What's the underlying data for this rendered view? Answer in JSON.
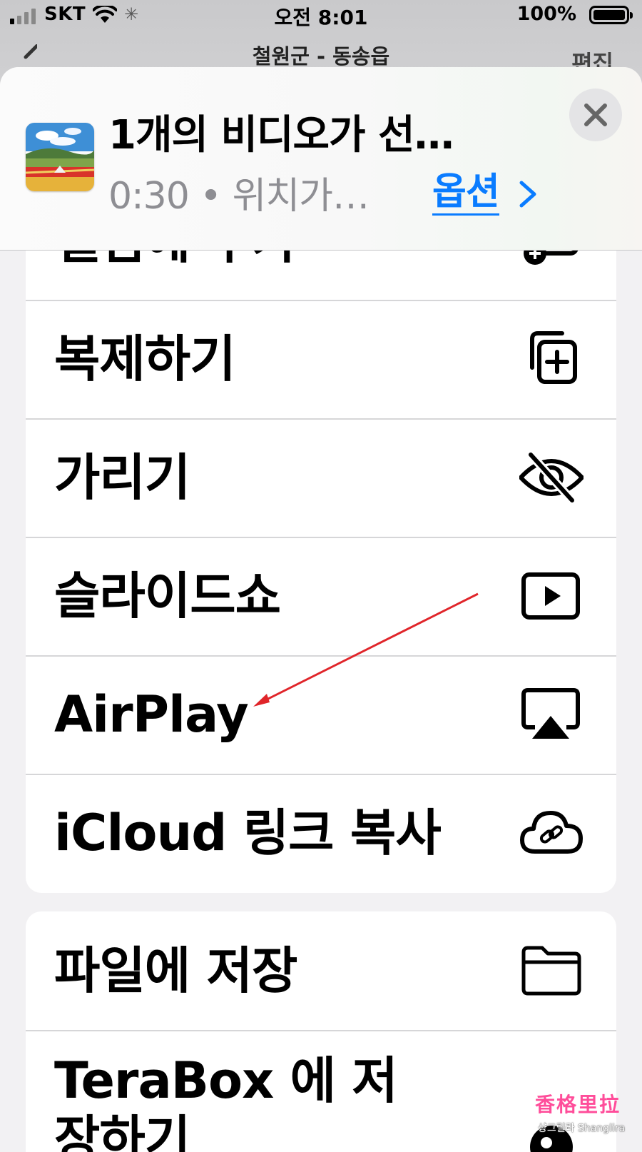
{
  "status_bar": {
    "carrier": "SKT",
    "time": "오전 8:01",
    "battery": "100%",
    "icons": [
      "signal-icon",
      "wifi-icon",
      "activity-spinner-icon",
      "battery-icon"
    ]
  },
  "nav": {
    "title": "철원군 - 동송읍",
    "edit_label": "편집",
    "back_icon": "chevron-left-icon"
  },
  "share_header": {
    "title": "1개의 비디오가 선…",
    "subtitle": "0:30 • 위치가…",
    "options_label": "옵션",
    "options_icon": "chevron-right-icon",
    "close_icon": "close-icon",
    "accent_color": "#0a7cff"
  },
  "actions_group_1": [
    {
      "label": "앨범에 추가",
      "icon": "add-to-album-icon"
    },
    {
      "label": "복제하기",
      "icon": "duplicate-icon"
    },
    {
      "label": "가리기",
      "icon": "eye-slash-icon"
    },
    {
      "label": "슬라이드쇼",
      "icon": "play-rectangle-icon"
    },
    {
      "label": "AirPlay",
      "icon": "airplay-icon"
    },
    {
      "label": "iCloud 링크 복사",
      "icon": "cloud-link-icon"
    }
  ],
  "actions_group_2": [
    {
      "label": "파일에 저장",
      "icon": "folder-icon"
    },
    {
      "label": "TeraBox 에 저장하기",
      "icon": "terabox-icon"
    }
  ],
  "watermark": {
    "title": "香格里拉",
    "subtitle": "샹그릴라 Shanglira"
  }
}
